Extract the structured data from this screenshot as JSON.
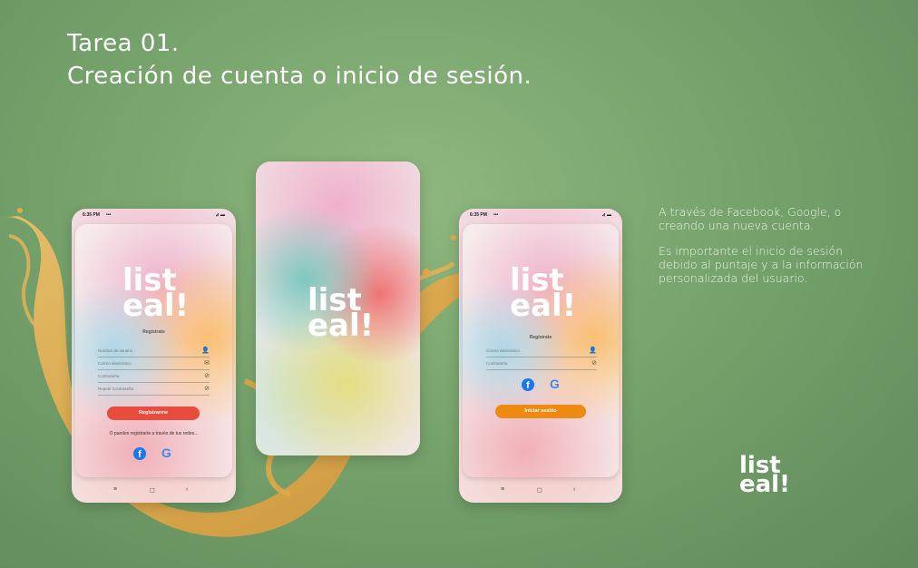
{
  "slide": {
    "title_line1": "Tarea 01.",
    "title_line2": "Creación de cuenta o inicio de sesión.",
    "description_p1": "A través de Facebook, Google, o creando una nueva cuenta.",
    "description_p2": "Es importante el inicio de sesión debido al puntaje y a la información personalizada del usuario."
  },
  "brand": {
    "logo_line1": "list",
    "logo_line2": "eal!"
  },
  "status_bar": {
    "time": "6:35 PM",
    "dots": "•••",
    "signal": "⊿ ▬"
  },
  "register_screen": {
    "heading": "Regístrate",
    "fields": [
      {
        "placeholder": "Nombre de usuario",
        "icon": "user-icon"
      },
      {
        "placeholder": "Correo electrónico",
        "icon": "mail-icon"
      },
      {
        "placeholder": "Contraseña",
        "icon": "eye-off-icon"
      },
      {
        "placeholder": "Repetir Contraseña",
        "icon": "eye-off-icon"
      }
    ],
    "submit_label": "Registrarme",
    "social_text": "O puedes registrarte a través de tus redes...",
    "button_color": "#e74c3c"
  },
  "login_screen": {
    "heading": "Regístrate",
    "fields": [
      {
        "placeholder": "Correo electrónico",
        "icon": "user-icon"
      },
      {
        "placeholder": "Contraseña",
        "icon": "eye-off-icon"
      }
    ],
    "submit_label": "Iniciar sesión",
    "button_color": "#ec8a12"
  },
  "social": {
    "facebook_glyph": "f",
    "google_glyph": "G"
  },
  "nav_bar": {
    "menu": "≡",
    "home": "◻",
    "back": "‹"
  }
}
